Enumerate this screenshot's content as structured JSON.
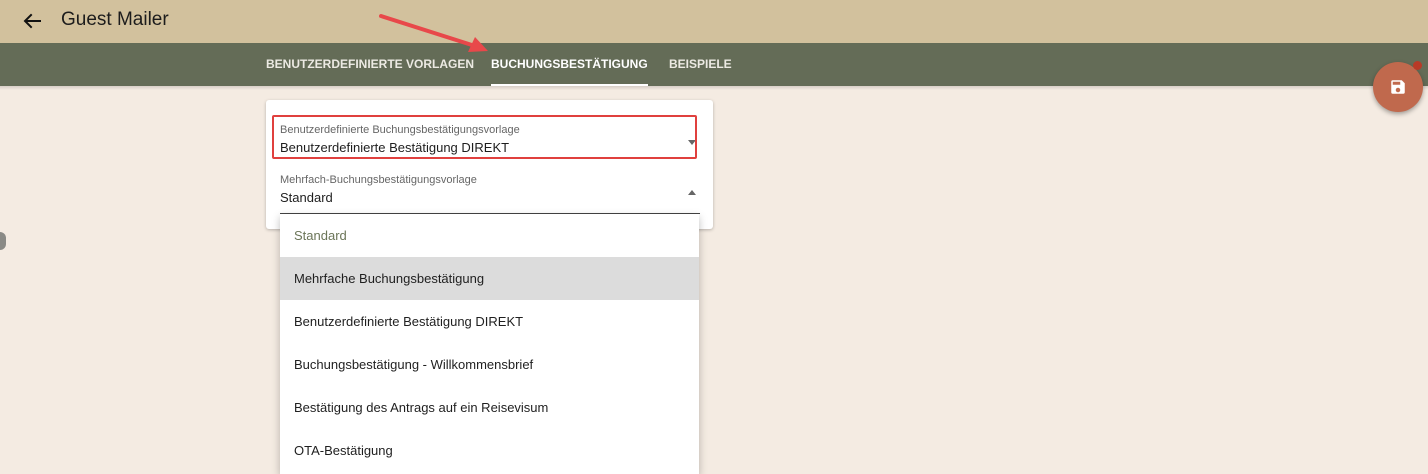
{
  "header": {
    "back_icon": "arrow-left-icon",
    "title": "Guest Mailer"
  },
  "tabs": [
    {
      "label": "BENUTZERDEFINIERTE VORLAGEN",
      "active": false
    },
    {
      "label": "BUCHUNGSBESTÄTIGUNG",
      "active": true
    },
    {
      "label": "BEISPIELE",
      "active": false
    }
  ],
  "form": {
    "booking_template": {
      "label": "Benutzerdefinierte Buchungsbestätigungsvorlage",
      "value": "Benutzerdefinierte Bestätigung DIREKT"
    },
    "multi_booking_template": {
      "label": "Mehrfach-Buchungsbestätigungsvorlage",
      "value": "Standard"
    }
  },
  "dropdown": {
    "options": [
      "Standard",
      "Mehrfache Buchungsbestätigung",
      "Benutzerdefinierte Bestätigung DIREKT",
      "Buchungsbestätigung - Willkommensbrief",
      "Bestätigung des Antrags auf ein Reisevisum",
      "OTA-Bestätigung"
    ],
    "selected": "Standard",
    "hovered": "Mehrfache Buchungsbestätigung"
  },
  "fab": {
    "icon": "save-icon"
  },
  "colors": {
    "topbar": "#d2c19d",
    "tabbar": "#646c57",
    "background": "#f4ebe2",
    "fab": "#c0694d",
    "highlight": "#e0403e"
  }
}
